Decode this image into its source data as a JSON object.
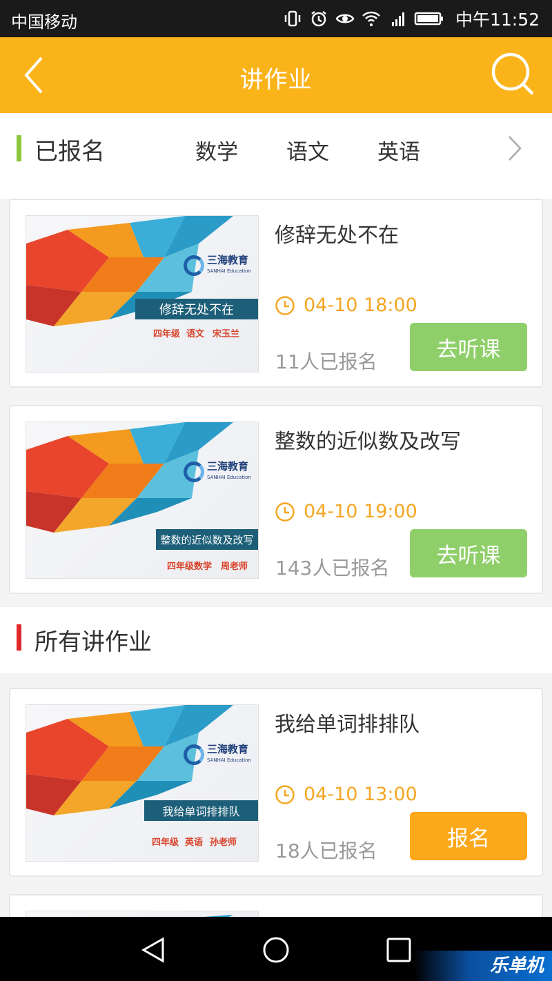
{
  "status_bar": {
    "carrier": "中国移动",
    "time": "中午11:52"
  },
  "app_bar": {
    "title": "讲作业"
  },
  "registered_section": {
    "label": "已报名",
    "tabs": [
      "数学",
      "语文",
      "英语"
    ]
  },
  "all_section": {
    "label": "所有讲作业"
  },
  "cards": [
    {
      "title": "修辞无处不在",
      "time": "04-10  18:00",
      "count": "11人已报名",
      "button": "去听课",
      "thumb": {
        "logo": "三海教育",
        "logo_sub": "SANHAI Education",
        "banner": "修辞无处不在",
        "meta": [
          "四年级",
          "语文",
          "宋玉兰"
        ]
      }
    },
    {
      "title": "整数的近似数及改写",
      "time": "04-10  19:00",
      "count": "143人已报名",
      "button": "去听课",
      "thumb": {
        "logo": "三海教育",
        "logo_sub": "SANHAI Education",
        "banner": "整数的近似数及改写",
        "meta": [
          "四年级数学",
          "周老师"
        ]
      }
    },
    {
      "title": "我给单词排排队",
      "time": "04-10  13:00",
      "count": "18人已报名",
      "button": "报名",
      "thumb": {
        "logo": "三海教育",
        "logo_sub": "SANHAI Education",
        "banner": "我给单词排排队",
        "meta": [
          "四年级",
          "英语",
          "孙老师"
        ]
      }
    }
  ],
  "watermark": "乐单机",
  "colors": {
    "accent": "#fbb31a",
    "green_button": "#8fcf6a",
    "orange_button": "#fba81a",
    "time_text": "#f5a623"
  },
  "icons": [
    "back-icon",
    "search-icon",
    "chevron-right-icon",
    "clock-icon",
    "nav-back-icon",
    "nav-home-icon",
    "nav-recents-icon"
  ]
}
